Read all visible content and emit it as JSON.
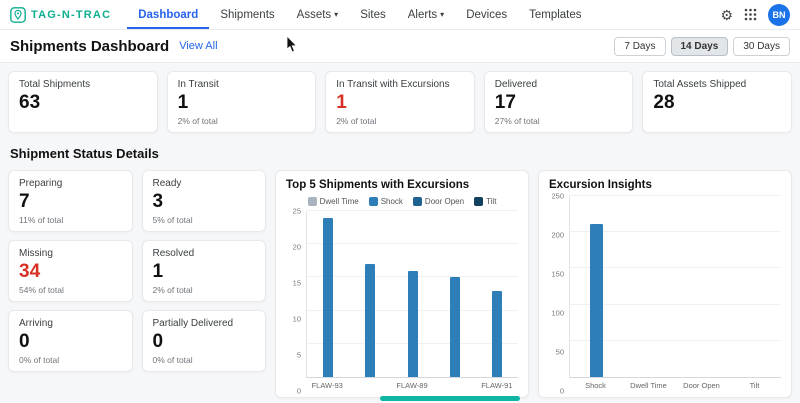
{
  "brand": {
    "name": "TAG-N-TRAC"
  },
  "icons": {
    "chevron": "▾",
    "settings": "⚙"
  },
  "colors": {
    "accent_teal": "#0eae8f",
    "active_blue": "#2563eb",
    "alert_red": "#d93025",
    "bar_blue": "#2e7fb8"
  },
  "nav": {
    "items": [
      {
        "label": "Dashboard",
        "active": true
      },
      {
        "label": "Shipments",
        "active": false
      },
      {
        "label": "Assets",
        "active": false,
        "chevron": true
      },
      {
        "label": "Sites",
        "active": false
      },
      {
        "label": "Alerts",
        "active": false,
        "chevron": true
      },
      {
        "label": "Devices",
        "active": false
      },
      {
        "label": "Templates",
        "active": false
      }
    ],
    "avatar_initials": "BN"
  },
  "header": {
    "title": "Shipments Dashboard",
    "view_all": "View All",
    "ranges": [
      {
        "label": "7 Days",
        "active": false
      },
      {
        "label": "14 Days",
        "active": true
      },
      {
        "label": "30 Days",
        "active": false
      }
    ]
  },
  "kpis": [
    {
      "label": "Total Shipments",
      "value": "63",
      "sub": ""
    },
    {
      "label": "In Transit",
      "value": "1",
      "sub": "2% of total"
    },
    {
      "label": "In Transit with Excursions",
      "value": "1",
      "sub": "2% of total",
      "alert": true
    },
    {
      "label": "Delivered",
      "value": "17",
      "sub": "27% of total"
    },
    {
      "label": "Total Assets Shipped",
      "value": "28",
      "sub": ""
    }
  ],
  "status_section": {
    "title": "Shipment Status Details",
    "cards": [
      {
        "label": "Preparing",
        "value": "7",
        "sub": "11% of total"
      },
      {
        "label": "Ready",
        "value": "3",
        "sub": "5% of total"
      },
      {
        "label": "Missing",
        "value": "34",
        "sub": "54% of total",
        "alert": true
      },
      {
        "label": "Resolved",
        "value": "1",
        "sub": "2% of total"
      },
      {
        "label": "Arriving",
        "value": "0",
        "sub": "0% of total"
      },
      {
        "label": "Partially Delivered",
        "value": "0",
        "sub": "0% of total"
      }
    ]
  },
  "chart_data": [
    {
      "type": "bar",
      "title": "Top 5 Shipments with Excursions",
      "legend": [
        "Dwell Time",
        "Shock",
        "Door Open",
        "Tilt"
      ],
      "legend_colors": [
        "#a9b4bf",
        "#2e7fb8",
        "#1f6390",
        "#12405e"
      ],
      "legend_position": "top",
      "categories": [
        "FLAW-93",
        "",
        "FLAW-89",
        "",
        "FLAW-91"
      ],
      "series": [
        {
          "name": "Shock",
          "values": [
            24,
            17,
            16,
            15,
            13
          ]
        }
      ],
      "bar_color": "#2e7fb8",
      "ylim": [
        0,
        25
      ],
      "yticks": [
        0,
        5,
        10,
        15,
        20,
        25
      ],
      "grid": true
    },
    {
      "type": "bar",
      "title": "Excursion Insights",
      "categories": [
        "Shock",
        "Dwell Time",
        "Door Open",
        "Tilt"
      ],
      "series": [
        {
          "name": "Excursions",
          "values": [
            212,
            0,
            0,
            0
          ]
        }
      ],
      "bar_color": "#2e7fb8",
      "ylim": [
        0,
        250
      ],
      "yticks": [
        0,
        50,
        100,
        150,
        200,
        250
      ],
      "grid": true
    }
  ]
}
